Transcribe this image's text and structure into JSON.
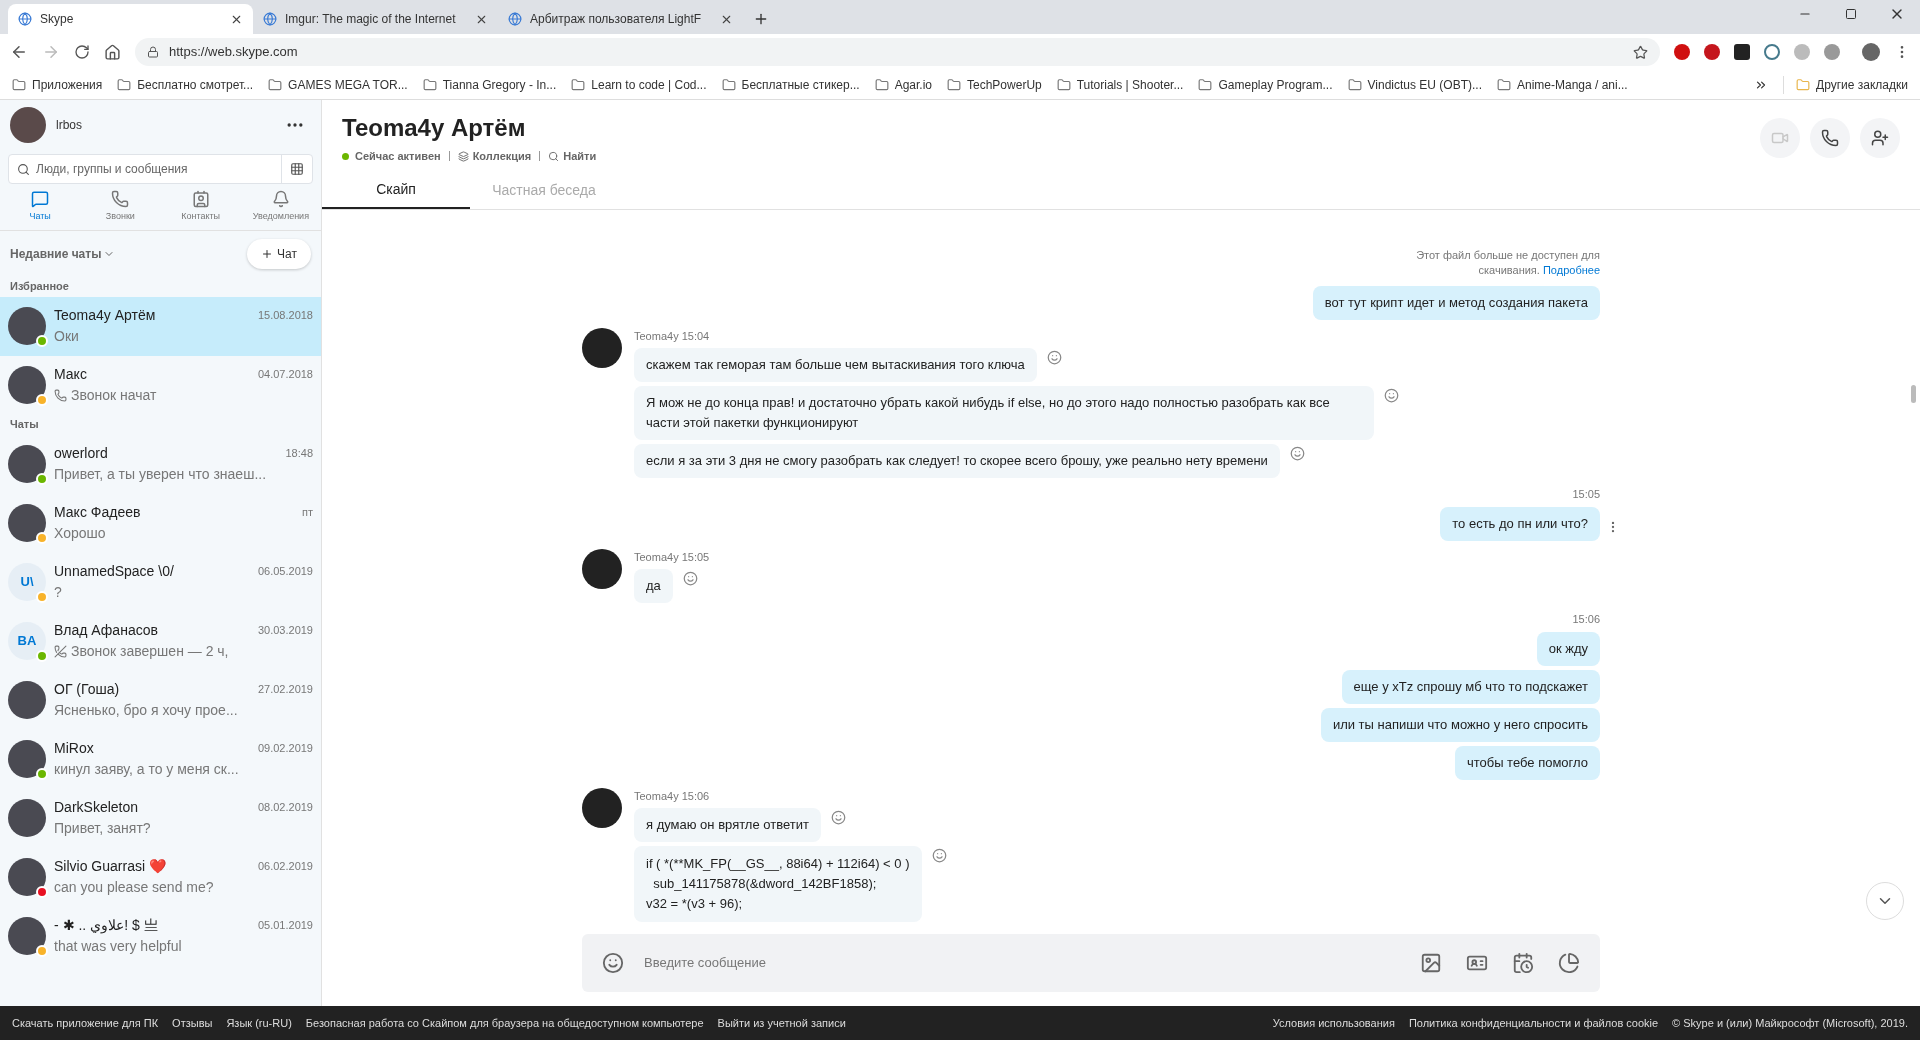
{
  "browser": {
    "tabs": [
      {
        "title": "Skype",
        "selected": true
      },
      {
        "title": "Imgur: The magic of the Internet",
        "selected": false
      },
      {
        "title": "Арбитраж пользователя LightF",
        "selected": false
      }
    ],
    "url": "https://web.skype.com",
    "bookmarks": [
      "Приложения",
      "Бесплатно смотрет...",
      "GAMES MEGA TOR...",
      "Tianna Gregory - In...",
      "Learn to code | Cod...",
      "Бесплатные стикер...",
      "Agar.io",
      "TechPowerUp",
      "Tutorials | Shooter...",
      "Gameplay Program...",
      "Vindictus EU (OBT)...",
      "Anime-Manga / ani..."
    ],
    "other_bookmarks": "Другие закладки"
  },
  "profile": {
    "name": "lrbos"
  },
  "search": {
    "placeholder": "Люди, группы и сообщения"
  },
  "nav": [
    {
      "label": "Чаты",
      "kind": "chat",
      "selected": true
    },
    {
      "label": "Звонки",
      "kind": "call",
      "selected": false
    },
    {
      "label": "Контакты",
      "kind": "contacts",
      "selected": false
    },
    {
      "label": "Уведомления",
      "kind": "bell",
      "selected": false
    }
  ],
  "recent_label": "Недавние чаты",
  "new_chat": "Чат",
  "sections": [
    {
      "title": "Избранное",
      "chats": [
        {
          "name": "Teoma4y Артём",
          "date": "15.08.2018",
          "preview": "Оки",
          "kind": "text",
          "color": "#6bb700",
          "selected": true
        },
        {
          "name": "Макс",
          "date": "04.07.2018",
          "preview": "Звонок начат",
          "kind": "call",
          "color": "#f8b32a",
          "selected": false
        }
      ]
    },
    {
      "title": "Чаты",
      "chats": [
        {
          "name": "owerlord",
          "date": "18:48",
          "preview": "Привет, а ты уверен что знаеш...",
          "color": "#6bb700",
          "selected": false
        },
        {
          "name": "Макс Фадеев",
          "date": "пт",
          "preview": "Хорошо",
          "color": "#f8b32a",
          "selected": false
        },
        {
          "name": "UnnamedSpace \\0/",
          "initials": "U\\",
          "date": "06.05.2019",
          "preview": "?",
          "color": "#f8b32a",
          "selected": false
        },
        {
          "name": "Влад Афанасов",
          "initials": "BA",
          "date": "30.03.2019",
          "preview": "Звонок завершен — 2 ч,",
          "kind": "call_end",
          "color": "#6bb700",
          "selected": false
        },
        {
          "name": "ОГ (Гоша)",
          "date": "27.02.2019",
          "preview": "Ясненько, бро я хочу прое...",
          "selected": false
        },
        {
          "name": "MiRox",
          "date": "09.02.2019",
          "preview": "кинул заяву, а то у меня ск...",
          "color": "#6bb700",
          "selected": false
        },
        {
          "name": "DarkSkeleton",
          "date": "08.02.2019",
          "preview": "Привет, занят?",
          "selected": false
        },
        {
          "name": "Silvio Guarrasi ❤️",
          "date": "06.02.2019",
          "preview": "can you please send me?",
          "color": "#e81123",
          "selected": false
        },
        {
          "name": "- ✱ .. علاوي! $ 亗",
          "date": "05.01.2019",
          "preview": "that was very helpful",
          "color": "#f8b32a",
          "selected": false
        }
      ]
    }
  ],
  "chat": {
    "title": "Teoma4y Артём",
    "status": "Сейчас активен",
    "links": [
      "Коллекция",
      "Найти"
    ],
    "tabs": [
      {
        "label": "Скайп",
        "selected": true
      },
      {
        "label": "Частная беседа",
        "selected": false
      }
    ],
    "messages": [
      {
        "kind": "notice",
        "text": "Этот файл больше не доступен для скачивания.",
        "link": "Подробнее"
      },
      {
        "kind": "out",
        "bubbles": [
          "вот тут крипт идет и метод создания пакета"
        ]
      },
      {
        "kind": "in",
        "sender": "Teoma4y 15:04",
        "bubbles": [
          {
            "kind": "text",
            "text": "скажем так геморая там больше чем вытаскивания того ключа"
          },
          {
            "kind": "text",
            "text": "Я мож не до конца прав! и достаточно убрать какой нибудь if else, но до этого надо полностью разобрать как все части этой пакетки функционируют"
          },
          {
            "kind": "text",
            "text": "если я за эти 3 дня не смогу разобрать как следует! то скорее всего брошу, уже реально нету времени"
          }
        ]
      },
      {
        "kind": "out",
        "time": "15:05",
        "bubbles": [
          "то есть до пн или что?"
        ]
      },
      {
        "kind": "in",
        "sender": "Teoma4y 15:05",
        "bubbles": [
          {
            "kind": "text",
            "text": "да"
          }
        ]
      },
      {
        "kind": "out",
        "time": "15:06",
        "bubbles": [
          "ок жду",
          "еще у xTz спрошу мб что то подскажет",
          "или ты напиши что можно у него спросить",
          "чтобы тебе помогло"
        ]
      },
      {
        "kind": "in",
        "sender": "Teoma4y 15:06",
        "bubbles": [
          {
            "kind": "text",
            "text": "я думаю он врятле ответит"
          },
          {
            "kind": "code",
            "lines": [
              "if ( *(**MK_FP(__GS__, 88i64) + 112i64) < 0 )",
              "  sub_141175878(&dword_142BF1858);",
              "v32 = *(v3 + 96);"
            ]
          }
        ]
      }
    ],
    "composer": {
      "placeholder": "Введите сообщение"
    }
  },
  "footer": {
    "left": [
      "Скачать приложение для ПК",
      "Отзывы",
      "Язык (ru-RU)",
      "Безопасная работа со Скайпом для браузера на общедоступном компьютере",
      "Выйти из учетной записи"
    ],
    "right": [
      "Условия использования",
      "Политика конфиденциальности и файлов cookie",
      "© Skype и (или) Майкрософт (Microsoft), 2019."
    ]
  }
}
